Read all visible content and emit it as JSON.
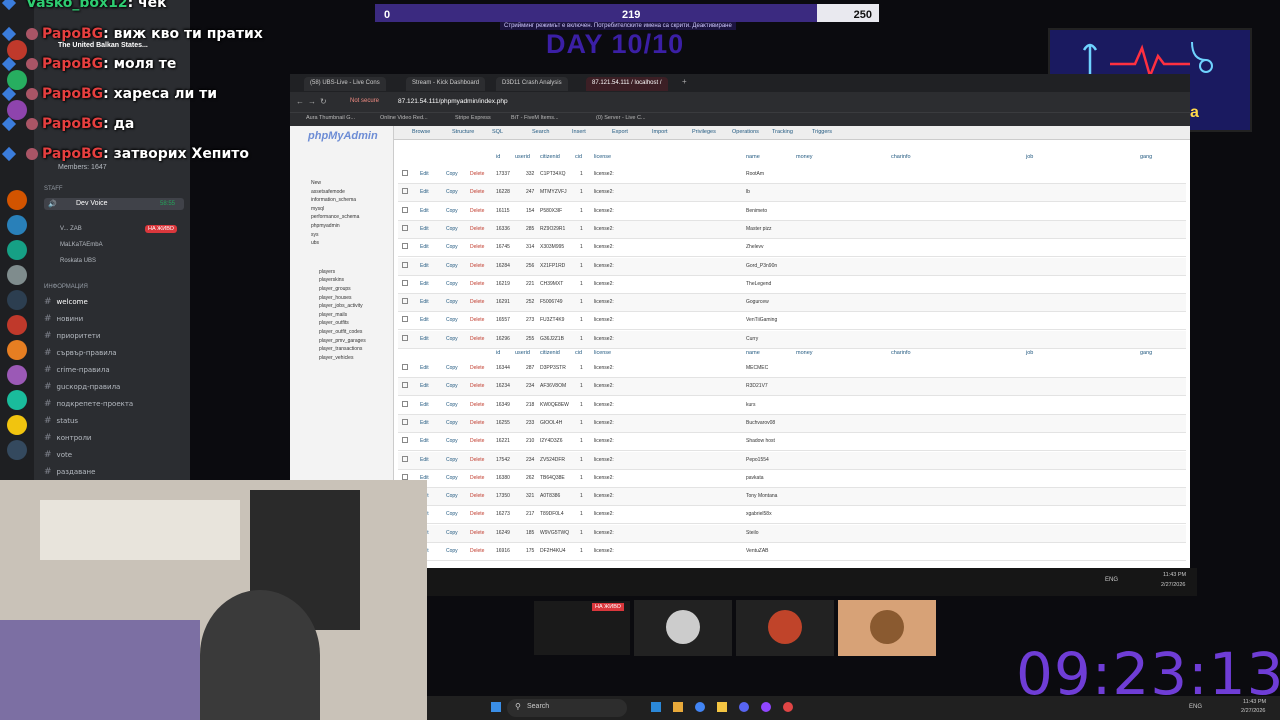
{
  "top_chat_partial": {
    "user": "Vasko_box12",
    "text": ": чек"
  },
  "chat": [
    {
      "user": "PapoBG",
      "text": ": виж кво ти пратих"
    },
    {
      "user": "PapoBG",
      "text": ": моля те"
    },
    {
      "user": "PapoBG",
      "text": ": хареса ли ти"
    },
    {
      "user": "PapoBG",
      "text": ": да"
    },
    {
      "user": "PapoBG",
      "text": ": затворих Хепито"
    }
  ],
  "score": {
    "left": "0",
    "mid": "219",
    "right": "250",
    "progress": 0.876
  },
  "banner_note": "Стрийминг режимът е включен. Потребителските имена са скрити. Деактивиране",
  "day_label": "DAY 10/10",
  "sponsor": {
    "line1": "sponsored by",
    "line2": "Pehlivankata"
  },
  "discord": {
    "server_name": "The United Balkan States...",
    "members": "Members: 1647",
    "staff_label": "STAFF",
    "voice_channel": "Dev Voice",
    "voice_time": "58:55",
    "voice_users": [
      "V... ZAB",
      "MaLKaTAEmbA",
      "Roskata UBS"
    ],
    "live_badge": "НА ЖИВО",
    "info_label": "ИНФОРМАЦИЯ",
    "channels": [
      "welcome",
      "новини",
      "приоритети",
      "сървър-правила",
      "crime-правила",
      "gucкорд-правила",
      "подкрепете-проекта",
      "status",
      "контроли",
      "vote",
      "раздаване"
    ]
  },
  "browser": {
    "tabs": [
      "(58) UBS-Live - Live Cons",
      "Stream - Kick Dashboard",
      "D3D11 Crash Analysis",
      "87.121.54.111 / localhost /"
    ],
    "url": "87.121.54.111/phpmyadmin/index.php",
    "not_secure": "Not secure",
    "bookmarks": [
      "Aura Thumbnail G...",
      "Online Video Red...",
      "Stripe Express",
      "BiT - FiveM Items...",
      "(0) Server - Live C..."
    ],
    "pma_logo": "phpMyAdmin",
    "pma_nav": [
      "Browse",
      "Structure",
      "SQL",
      "Search",
      "Insert",
      "Export",
      "Import",
      "Privileges",
      "Operations",
      "Tracking",
      "Triggers"
    ],
    "tree": [
      "New",
      "assetsafemode",
      "information_schema",
      "mysql",
      "performance_schema",
      "phpmyadmin",
      "sys",
      "ubs",
      "players",
      "playerskins",
      "player_groups",
      "player_houses",
      "player_jobs_activity",
      "player_mails",
      "player_outfits",
      "player_outfit_codes",
      "player_pmv_garages",
      "player_transactions",
      "player_vehicles"
    ],
    "columns": [
      "id",
      "userid",
      "citizenid",
      "cid",
      "license",
      "name",
      "money",
      "charinfo",
      "job",
      "gang"
    ],
    "rows": [
      {
        "id": "17337",
        "uid": "332",
        "cit": "C1PT34XQ",
        "name": "RootAm"
      },
      {
        "id": "16228",
        "uid": "247",
        "cit": "MTMYZVFJ",
        "name": "lb"
      },
      {
        "id": "16115",
        "uid": "154",
        "cit": "P580X3IF",
        "name": "Benimeto"
      },
      {
        "id": "16336",
        "uid": "285",
        "cit": "RZ9O29R1",
        "name": "Master pizz"
      },
      {
        "id": "16745",
        "uid": "314",
        "cit": "X303M995",
        "name": "Zhelevv"
      },
      {
        "id": "16284",
        "uid": "256",
        "cit": "X21FP1RD",
        "name": "Gord_P3n90n"
      },
      {
        "id": "16219",
        "uid": "221",
        "cit": "CH39MXT",
        "name": "TheLegend"
      },
      {
        "id": "16291",
        "uid": "252",
        "cit": "F5006749",
        "name": "Gogurcew"
      },
      {
        "id": "16557",
        "uid": "273",
        "cit": "FU3ZT4K9",
        "name": "VenTiiGaming"
      },
      {
        "id": "16296",
        "uid": "255",
        "cit": "G36J2Z1B",
        "name": "Curry"
      },
      {
        "id": "16344",
        "uid": "287",
        "cit": "D3PP3STR",
        "name": "MECMEC"
      },
      {
        "id": "16234",
        "uid": "234",
        "cit": "AF36V8OM",
        "name": "R3D21V7"
      },
      {
        "id": "16349",
        "uid": "218",
        "cit": "KW0QE8EW",
        "name": "kurs"
      },
      {
        "id": "16255",
        "uid": "233",
        "cit": "GIOOL4H",
        "name": "Buchvarov08"
      },
      {
        "id": "16221",
        "uid": "210",
        "cit": "I2Y4D3Z6",
        "name": "Shadow host"
      },
      {
        "id": "17542",
        "uid": "234",
        "cit": "ZV524DFR",
        "name": "Pepo1554"
      },
      {
        "id": "16380",
        "uid": "262",
        "cit": "TB64Q38E",
        "name": "pavkata"
      },
      {
        "id": "17350",
        "uid": "321",
        "cit": "A0T8386",
        "name": "Tony Montana"
      },
      {
        "id": "16273",
        "uid": "217",
        "cit": "T89DF0L4",
        "name": "xgabriel58x"
      },
      {
        "id": "16249",
        "uid": "185",
        "cit": "W9VG5TWQ",
        "name": "Steilo"
      },
      {
        "id": "16916",
        "uid": "175",
        "cit": "DF2H4KU4",
        "name": "VentuZAB"
      }
    ],
    "row_actions": [
      "Edit",
      "Copy",
      "Delete"
    ],
    "license_prefix": "license2:",
    "cid_value": "1"
  },
  "taskbar": {
    "search": "Search",
    "lang": "ENG",
    "time": "11:43 PM",
    "date": "2/27/2026"
  },
  "stream_live_badge": "НА ЖИВО",
  "big_clock": "09:23:13"
}
